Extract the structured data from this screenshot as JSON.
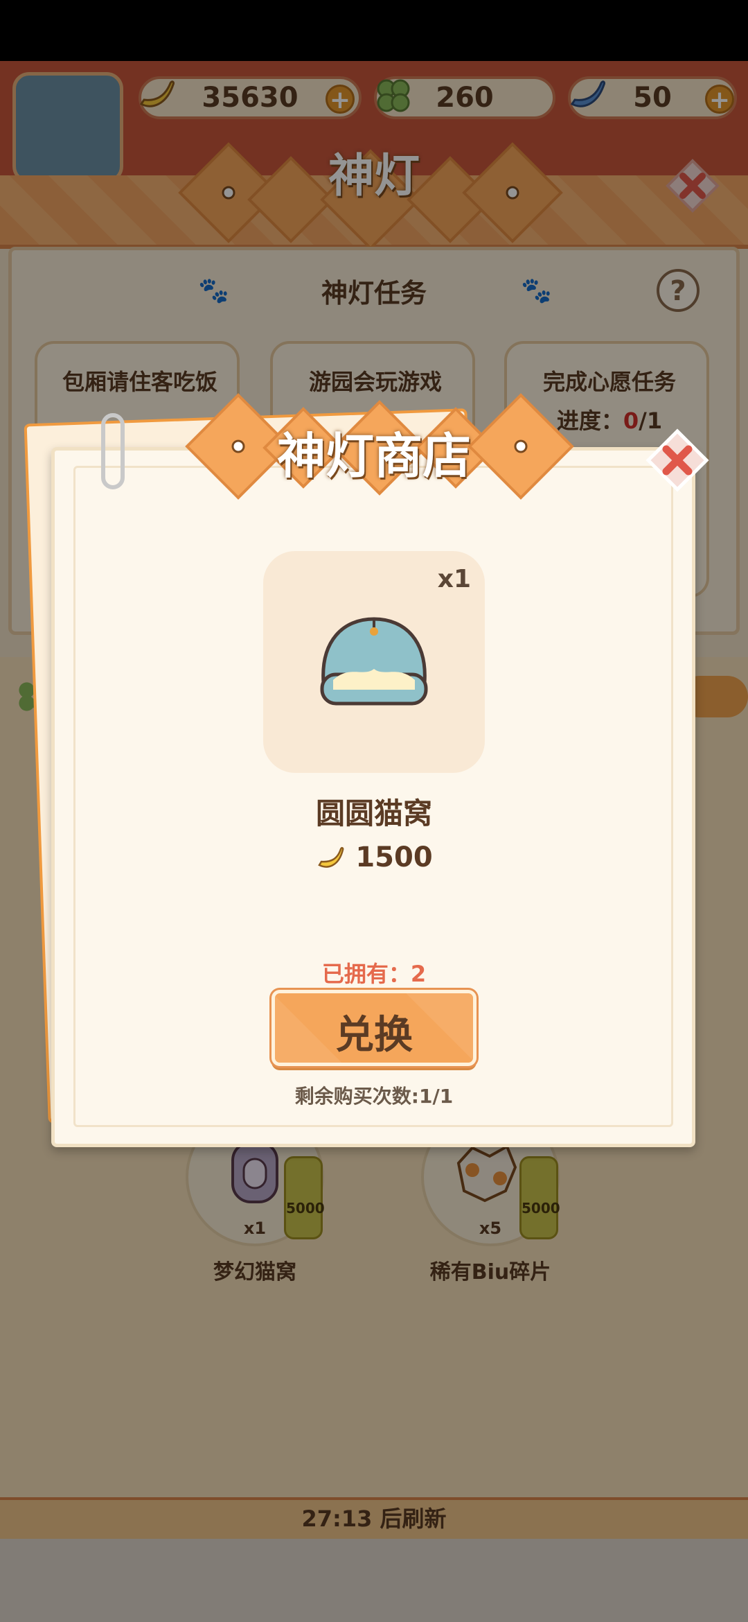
{
  "currencies": [
    {
      "name": "banana",
      "value": "35630",
      "has_plus": true
    },
    {
      "name": "clover",
      "value": "260",
      "has_plus": false
    },
    {
      "name": "blue-banana",
      "value": "50",
      "has_plus": true
    }
  ],
  "plus_symbol": "+",
  "lamp": {
    "title": "神灯",
    "task_header": "神灯任务",
    "help": "?",
    "tasks": [
      {
        "title": "包厢请住客吃饭",
        "progress_label": "",
        "progress_value": "",
        "progress_total": ""
      },
      {
        "title": "游园会玩游戏",
        "progress_label": "",
        "progress_value": "",
        "progress_total": ""
      },
      {
        "title": "完成心愿任务",
        "progress_label": "进度：",
        "progress_value": "0",
        "progress_total": "/1"
      }
    ]
  },
  "shop_bg_items": [
    {
      "name": "梦幻猫窝",
      "count": "x1",
      "price": "5000"
    },
    {
      "name": "稀有Biu碎片",
      "count": "x5",
      "price": "5000"
    }
  ],
  "refresh": "27:13 后刷新",
  "modal": {
    "title": "神灯商店",
    "item": {
      "name": "圆圆猫窝",
      "quantity": "x1",
      "price": "1500",
      "owned_label": "已拥有：2"
    },
    "exchange_button": "兑换",
    "remaining": "剩余购买次数:1/1"
  },
  "colors": {
    "accent_orange": "#f5a65b",
    "title_shadow": "#7a4a1f",
    "owned_red": "#e56a4c",
    "brown_text": "#5b3b24"
  }
}
